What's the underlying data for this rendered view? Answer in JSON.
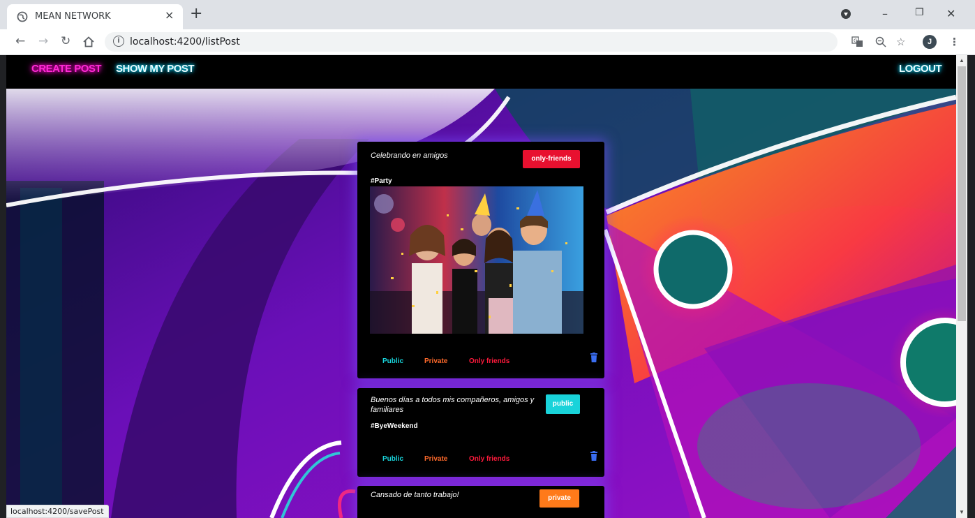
{
  "browser": {
    "tab_title": "MEAN NETWORK",
    "tab_close": "×",
    "new_tab": "+",
    "url": "localhost:4200/listPost",
    "avatar_initial": "J",
    "status_url": "localhost:4200/savePost"
  },
  "nav": {
    "create_post": "CREATE POST",
    "show_my_post": "SHOW MY POST",
    "logout": "LOGOUT"
  },
  "posts": [
    {
      "text": "Celebrando en amigos",
      "hashtag": "#Party",
      "visibility": "only-friends",
      "badge_color": "#e8102f",
      "has_image": true
    },
    {
      "text": "Buenos días a todos mis compañeros, amigos y familiares",
      "hashtag": "#ByeWeekend",
      "visibility": "public",
      "badge_color": "#19d3da",
      "has_image": false
    },
    {
      "text": "Cansado de tanto trabajo!",
      "visibility": "private",
      "badge_color": "#ff7a1a"
    }
  ],
  "visibility_options": {
    "public": "Public",
    "private": "Private",
    "only_friends": "Only friends"
  },
  "colors": {
    "neon_pink": "#ff2bd6",
    "neon_cyan": "#00e5ff",
    "option_public": "#19d3da",
    "option_private": "#ff6a2b",
    "option_friends": "#ff1a3c",
    "trash": "#3a6df0"
  },
  "icons": [
    "globe-icon",
    "back-arrow-icon",
    "forward-arrow-icon",
    "reload-icon",
    "home-icon",
    "info-icon",
    "translate-icon",
    "zoom-icon",
    "star-icon",
    "menu-icon",
    "trash-icon",
    "extension-icon"
  ]
}
